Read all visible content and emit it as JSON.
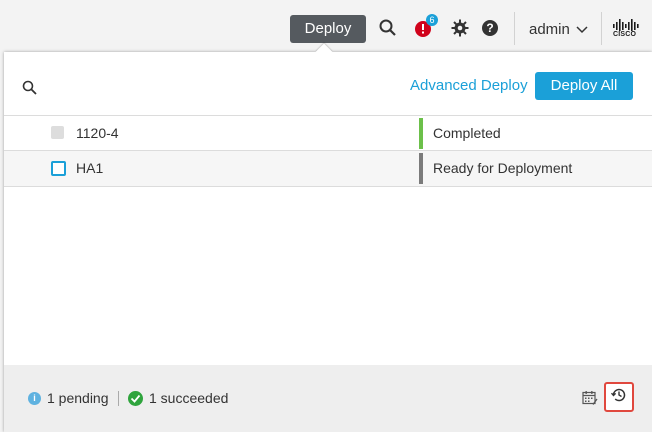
{
  "header": {
    "deploy_label": "Deploy",
    "notification_count": "6",
    "user": "admin",
    "logo_text": "CISCO"
  },
  "panel": {
    "advanced_deploy_label": "Advanced Deploy",
    "deploy_all_label": "Deploy All",
    "rows": [
      {
        "name": "1120-4",
        "status": "Completed",
        "status_color": "#6cc04a",
        "selectable": false
      },
      {
        "name": "HA1",
        "status": "Ready for Deployment",
        "status_color": "#7b7b7b",
        "selectable": true
      }
    ]
  },
  "footer": {
    "pending": "1 pending",
    "succeeded": "1 succeeded"
  },
  "colors": {
    "accent": "#1ba0d8",
    "alert": "#d0021b",
    "success": "#2fa43d",
    "highlight": "#e0483e"
  }
}
